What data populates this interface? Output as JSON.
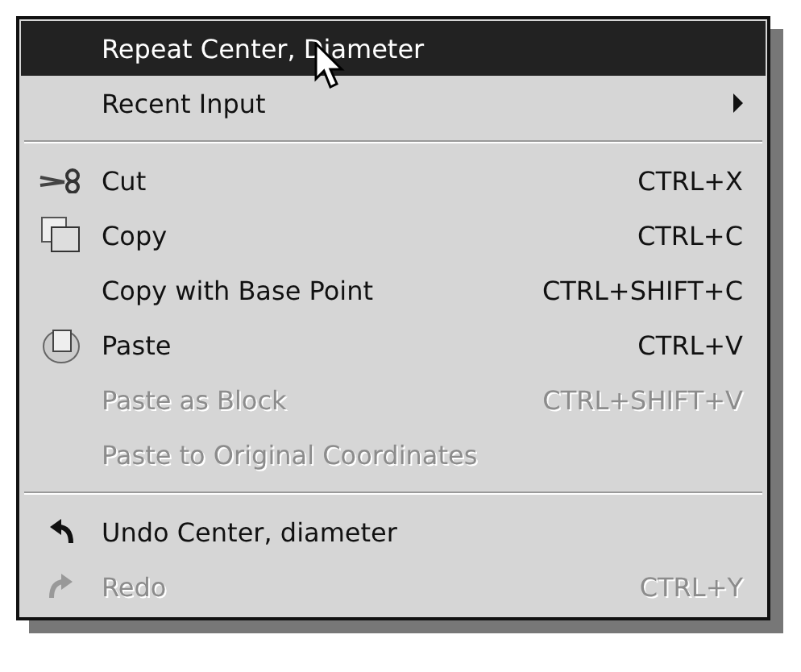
{
  "context_menu": {
    "items": [
      {
        "kind": "command",
        "label": "Repeat Center, Diameter",
        "selected": true,
        "disabled": false
      },
      {
        "kind": "submenu",
        "label": "Recent Input",
        "selected": false,
        "disabled": false
      },
      {
        "kind": "separator"
      },
      {
        "kind": "command",
        "label": "Cut",
        "shortcut": "CTRL+X",
        "selected": false,
        "disabled": false
      },
      {
        "kind": "command",
        "label": "Copy",
        "shortcut": "CTRL+C",
        "selected": false,
        "disabled": false
      },
      {
        "kind": "command",
        "label": "Copy with Base Point",
        "shortcut": "CTRL+SHIFT+C",
        "selected": false,
        "disabled": false
      },
      {
        "kind": "command",
        "label": "Paste",
        "shortcut": "CTRL+V",
        "selected": false,
        "disabled": false
      },
      {
        "kind": "command",
        "label": "Paste as Block",
        "shortcut": "CTRL+SHIFT+V",
        "selected": false,
        "disabled": true
      },
      {
        "kind": "command",
        "label": "Paste to Original Coordinates",
        "selected": false,
        "disabled": true
      },
      {
        "kind": "separator"
      },
      {
        "kind": "command",
        "label": "Undo Center, diameter",
        "selected": false,
        "disabled": false
      },
      {
        "kind": "command",
        "label": "Redo",
        "shortcut": "CTRL+Y",
        "selected": false,
        "disabled": true
      }
    ]
  }
}
